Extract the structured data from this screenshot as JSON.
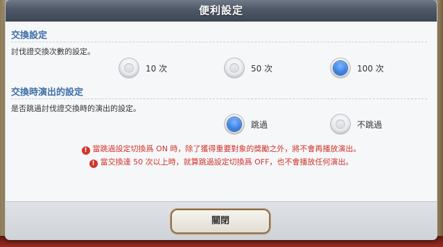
{
  "dialog": {
    "title": "便利設定",
    "close_label": "關閉"
  },
  "exchange_settings": {
    "title": "交換設定",
    "description": "討伐證交換次數的設定。",
    "options": [
      {
        "label": "10 次",
        "selected": false
      },
      {
        "label": "50 次",
        "selected": false
      },
      {
        "label": "100 次",
        "selected": true
      }
    ]
  },
  "performance_settings": {
    "title": "交換時演出的設定",
    "description": "是否跳過討伐證交換時的演出的設定。",
    "options": [
      {
        "label": "跳過",
        "selected": true
      },
      {
        "label": "不跳過",
        "selected": false
      }
    ]
  },
  "notices": [
    "當跳過設定切換爲 ON 時，除了獲得重要對象的獎勵之外，將不會再播放演出。",
    "當交換達 50 次以上時，就算跳過設定切換爲 OFF，也不會播放任何演出。"
  ],
  "colors": {
    "section_title": "#3f6fa8",
    "notice": "#d2342b",
    "radio_selected": "#3d86e6"
  }
}
